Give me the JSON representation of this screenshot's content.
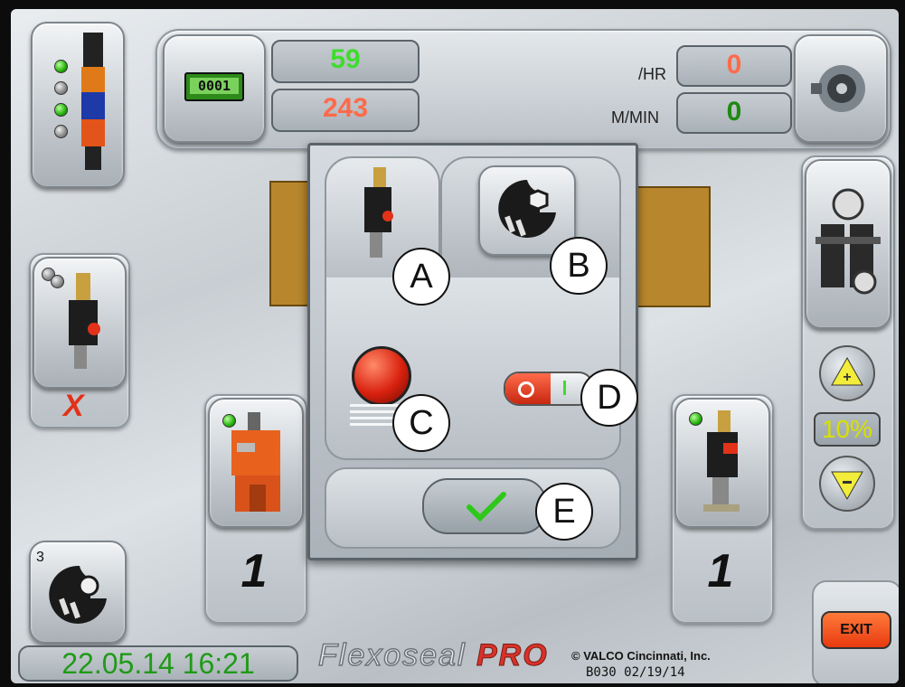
{
  "counters": {
    "digital_counter": "0001",
    "good_count": "59",
    "reject_count": "243",
    "rate_label": "/HR",
    "rate_value": "0",
    "speed_label": "M/MIN",
    "speed_value": "0"
  },
  "left_valve_status": "X",
  "lane_counts": {
    "left": "1",
    "right": "1"
  },
  "adjust_percent": "10%",
  "maintenance_badge": "3",
  "datetime": "22.05.14 16:21",
  "brand": {
    "name_part1": "Flexoseal",
    "name_part2": "PRO"
  },
  "copyright": "© VALCO Cincinnati, Inc.",
  "version": "B030 02/19/14",
  "exit_label": "EXIT",
  "callouts": {
    "a": "A",
    "b": "B",
    "c": "C",
    "d": "D",
    "e": "E"
  },
  "colors": {
    "good": "#3fdc2e",
    "reject": "#ff6a4a",
    "rate_value": "#ff6a4a",
    "speed_value": "#1e8a12",
    "datetime": "#1f9a17",
    "percent": "#d8e000",
    "exit": "#e83a10"
  }
}
